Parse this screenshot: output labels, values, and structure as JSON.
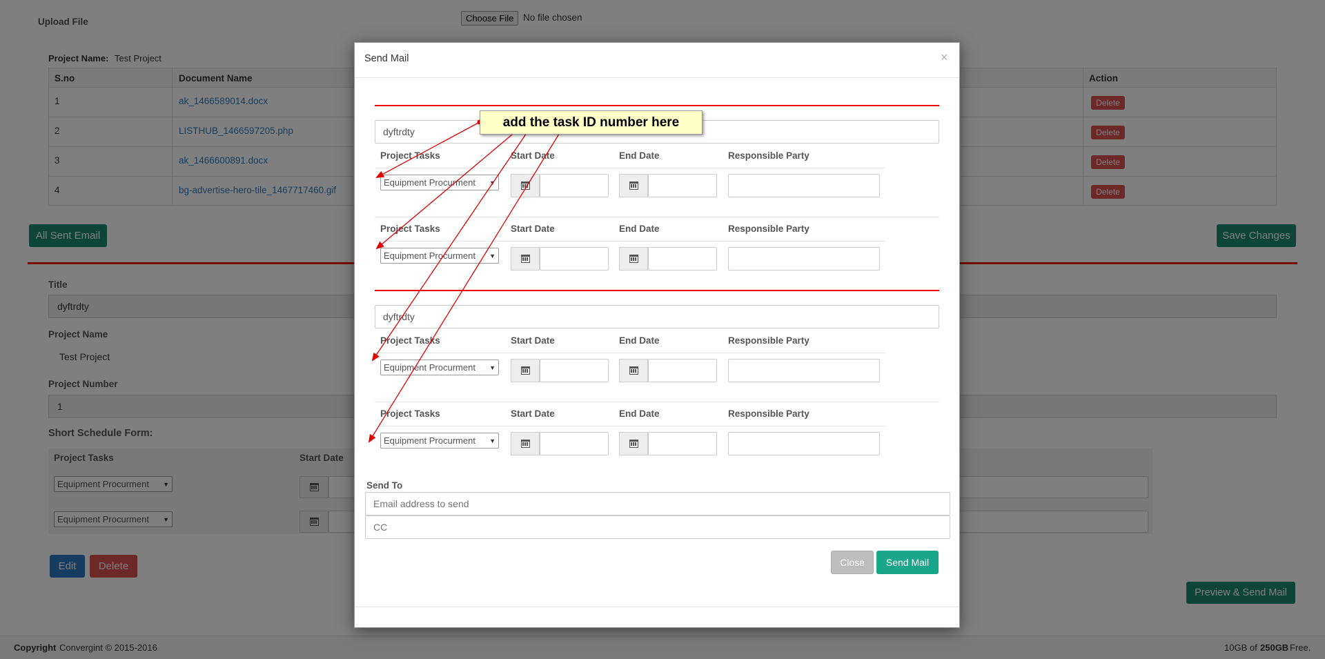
{
  "background": {
    "upload_label": "Upload File",
    "choose_file": "Choose File",
    "no_file": "No file chosen",
    "project_name_label": "Project Name:",
    "project_name_value": "Test Project",
    "table_headers": [
      "S.no",
      "Document Name",
      "Action"
    ],
    "rows": [
      {
        "sno": "1",
        "doc": "ak_1466589014.docx",
        "action": "Delete"
      },
      {
        "sno": "2",
        "doc": "LISTHUB_1466597205.php",
        "action": "Delete"
      },
      {
        "sno": "3",
        "doc": "ak_1466600891.docx",
        "action": "Delete"
      },
      {
        "sno": "4",
        "doc": "bg-advertise-hero-tile_1467717460.gif",
        "action": "Delete"
      }
    ],
    "all_sent_email": "All Sent Email",
    "save_changes": "Save Changes",
    "title_label": "Title",
    "title_value": "dyftrdty",
    "project_name_label2": "Project Name",
    "project_name_value2": "Test Project",
    "project_number_label": "Project Number",
    "project_number_value": "1",
    "short_schedule_label": "Short Schedule Form:",
    "col_tasks": "Project Tasks",
    "col_start": "Start Date",
    "task_option": "Equipment Procurment",
    "edit": "Edit",
    "delete": "Delete",
    "preview_send": "Preview & Send Mail",
    "footer_copyright_bold": "Copyright",
    "footer_copyright": "Convergint © 2015-2016",
    "footer_storage_used": "10GB of",
    "footer_storage_total": "250GB",
    "footer_storage_suffix": "Free."
  },
  "modal": {
    "title": "Send Mail",
    "close_x": "×",
    "title_value_1": "dyftrdty",
    "title_value_2": "dyftrdty",
    "headers": {
      "tasks": "Project Tasks",
      "start": "Start Date",
      "end": "End Date",
      "party": "Responsible Party"
    },
    "task_option": "Equipment Procurment",
    "send_to_label": "Send To",
    "email_placeholder": "Email address to send",
    "cc_placeholder": "CC",
    "close_button": "Close",
    "send_button": "Send Mail"
  },
  "annotation": {
    "callout": "add the task ID number here"
  },
  "colors": {
    "accent_green": "#1aa68a",
    "danger_red": "#d9534f",
    "primary_blue": "#2c79c2",
    "annotation_red": "#e00000",
    "callout_bg": "#ffffc8"
  }
}
